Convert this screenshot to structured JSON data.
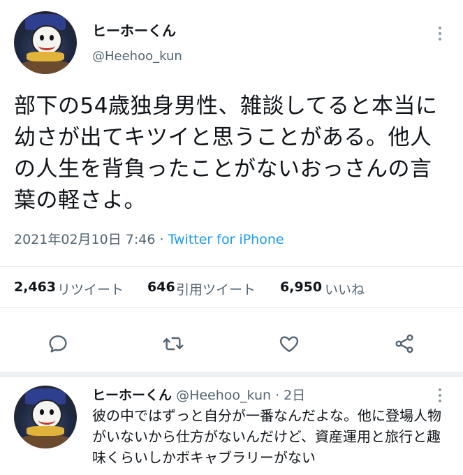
{
  "main_tweet": {
    "display_name": "ヒーホーくん",
    "handle": "@Heehoo_kun",
    "text": "部下の54歳独身男性、雑談してると本当に幼さが出てキツイと思うことがある。他人の人生を背負ったことがないおっさんの言葉の軽さよ。",
    "timestamp": "2021年02月10日 7:46",
    "separator": " · ",
    "source": "Twitter for iPhone",
    "stats": {
      "retweets_count": "2,463",
      "retweets_label": "リツイート",
      "quotes_count": "646",
      "quotes_label": "引用ツイート",
      "likes_count": "6,950",
      "likes_label": "いいね"
    },
    "actions": [
      "reply-icon",
      "retweet-icon",
      "like-icon",
      "share-icon"
    ]
  },
  "reply_tweet": {
    "display_name": "ヒーホーくん",
    "handle": "@Heehoo_kun",
    "dot": "·",
    "time": "2日",
    "text": "彼の中ではずっと自分が一番なんだよな。他に登場人物がいないから仕方がないんだけど、資産運用と旅行と趣味くらいしかボキャブラリーがない"
  },
  "colors": {
    "text": "#0f1419",
    "secondary": "#536471",
    "link": "#1d9bf0",
    "divider": "#e6ecf0"
  }
}
